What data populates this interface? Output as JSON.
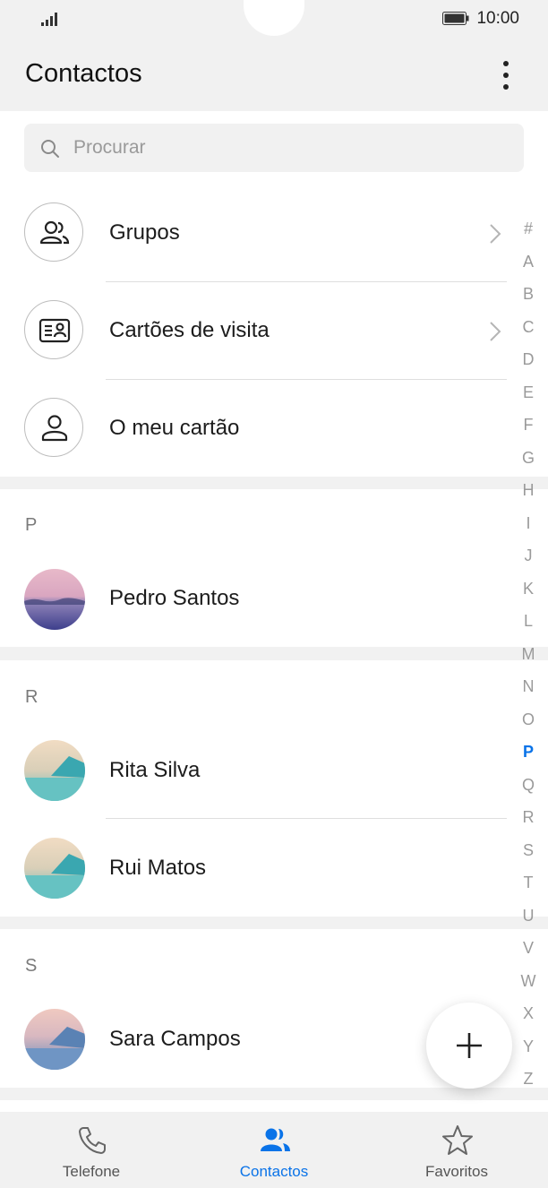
{
  "status": {
    "time": "10:00"
  },
  "header": {
    "title": "Contactos"
  },
  "search": {
    "placeholder": "Procurar"
  },
  "menu": [
    {
      "label": "Grupos"
    },
    {
      "label": "Cartões de visita"
    },
    {
      "label": "O meu cartão"
    }
  ],
  "sections": [
    {
      "letter": "P",
      "contacts": [
        "Pedro Santos"
      ]
    },
    {
      "letter": "R",
      "contacts": [
        "Rita Silva",
        "Rui Matos"
      ]
    },
    {
      "letter": "S",
      "contacts": [
        "Sara Campos"
      ]
    }
  ],
  "index": [
    "#",
    "A",
    "B",
    "C",
    "D",
    "E",
    "F",
    "G",
    "H",
    "I",
    "J",
    "K",
    "L",
    "M",
    "N",
    "O",
    "P",
    "Q",
    "R",
    "S",
    "T",
    "U",
    "V",
    "W",
    "X",
    "Y",
    "Z"
  ],
  "index_active": "P",
  "tabs": [
    {
      "label": "Telefone",
      "icon": "phone-icon"
    },
    {
      "label": "Contactos",
      "icon": "contacts-icon",
      "active": true
    },
    {
      "label": "Favoritos",
      "icon": "star-icon"
    }
  ],
  "colors": {
    "accent": "#0a73e8",
    "background": "#f1f1f1"
  }
}
